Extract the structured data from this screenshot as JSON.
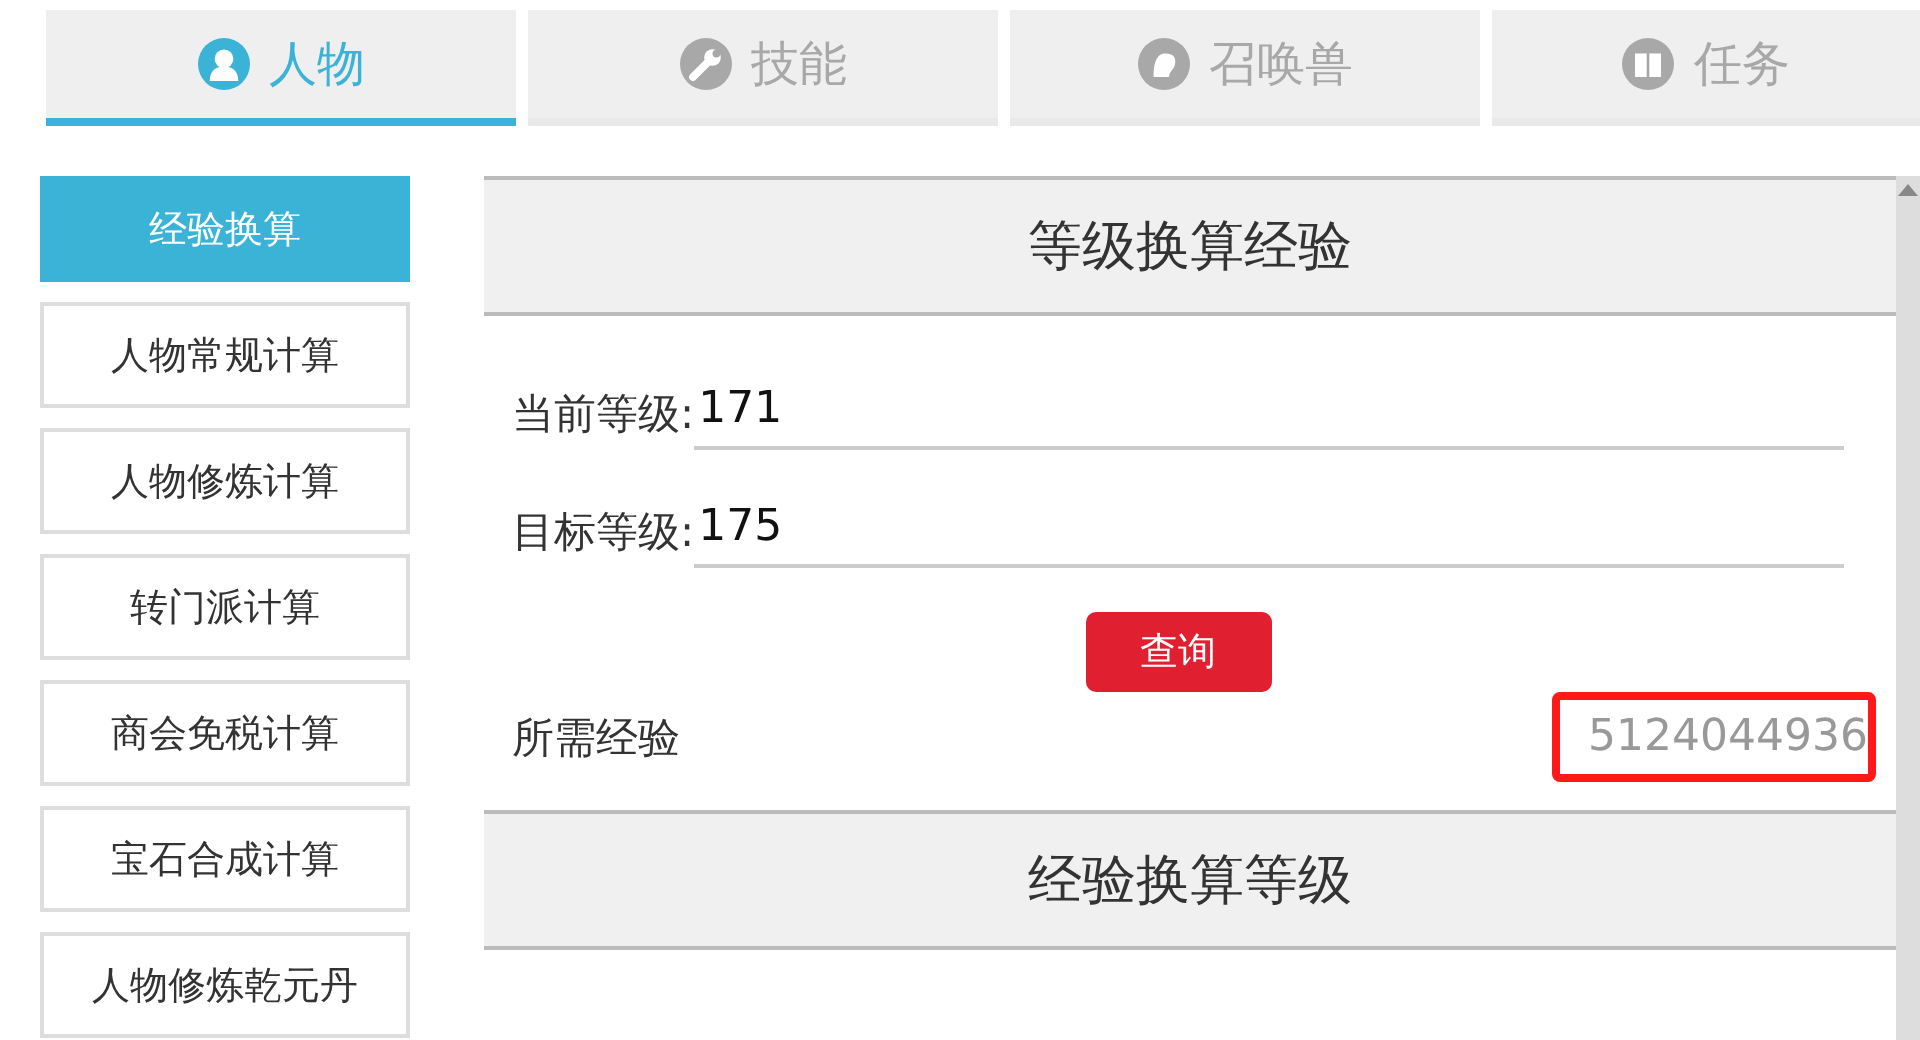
{
  "tabs": [
    {
      "label": "人物",
      "kind": "person",
      "selected": true
    },
    {
      "label": "技能",
      "kind": "wrench",
      "selected": false
    },
    {
      "label": "召唤兽",
      "kind": "beast",
      "selected": false
    },
    {
      "label": "任务",
      "kind": "book",
      "selected": false
    }
  ],
  "sidebar": {
    "items": [
      {
        "label": "经验换算",
        "selected": true
      },
      {
        "label": "人物常规计算",
        "selected": false
      },
      {
        "label": "人物修炼计算",
        "selected": false
      },
      {
        "label": "转门派计算",
        "selected": false
      },
      {
        "label": "商会免税计算",
        "selected": false
      },
      {
        "label": "宝石合成计算",
        "selected": false
      },
      {
        "label": "人物修炼乾元丹",
        "selected": false
      }
    ]
  },
  "sections": [
    {
      "title": "等级换算经验",
      "fields": [
        {
          "label": "当前等级:",
          "value": "171"
        },
        {
          "label": "目标等级:",
          "value": "175"
        }
      ],
      "button": "查询",
      "result": {
        "label": "所需经验",
        "value": "5124044936",
        "highlighted": true
      }
    },
    {
      "title": "经验换算等级"
    }
  ]
}
